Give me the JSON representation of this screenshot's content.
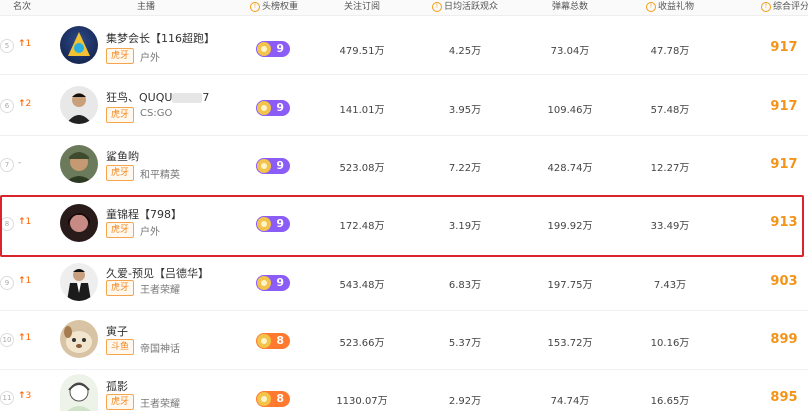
{
  "header": {
    "rank": "名次",
    "streamer": "主播",
    "weight": "头榜权重",
    "subscribers": "关注订阅",
    "daily_active": "日均活跃观众",
    "danmaku": "弹幕总数",
    "gifts": "收益礼物",
    "score": "综合评分"
  },
  "rows": [
    {
      "rank": "5",
      "trend": "1",
      "trend_dir": "up",
      "name": "集梦会长【116超跑】",
      "platform": "虎牙",
      "category": "户外",
      "weight": "9",
      "weight_tier": "purple",
      "subscribers": "479.51万",
      "daily_active": "4.25万",
      "danmaku": "73.04万",
      "gifts": "47.78万",
      "score": "917"
    },
    {
      "rank": "6",
      "trend": "2",
      "trend_dir": "up",
      "name_prefix": "狂鸟、QUQU",
      "name_suffix": "7",
      "platform": "虎牙",
      "category": "CS:GO",
      "weight": "9",
      "weight_tier": "purple",
      "subscribers": "141.01万",
      "daily_active": "3.95万",
      "danmaku": "109.46万",
      "gifts": "57.48万",
      "score": "917"
    },
    {
      "rank": "7",
      "trend": "-",
      "trend_dir": "flat",
      "name": "鲨鱼哟",
      "platform": "虎牙",
      "category": "和平精英",
      "weight": "9",
      "weight_tier": "purple",
      "subscribers": "523.08万",
      "daily_active": "7.22万",
      "danmaku": "428.74万",
      "gifts": "12.27万",
      "score": "917"
    },
    {
      "rank": "8",
      "trend": "1",
      "trend_dir": "up",
      "name": "童锦程【798】",
      "platform": "虎牙",
      "category": "户外",
      "weight": "9",
      "weight_tier": "purple",
      "subscribers": "172.48万",
      "daily_active": "3.19万",
      "danmaku": "199.92万",
      "gifts": "33.49万",
      "score": "913"
    },
    {
      "rank": "9",
      "trend": "1",
      "trend_dir": "up",
      "name": "久爱-预见【吕德华】",
      "platform": "虎牙",
      "category": "王者荣耀",
      "weight": "9",
      "weight_tier": "purple",
      "subscribers": "543.48万",
      "daily_active": "6.83万",
      "danmaku": "197.75万",
      "gifts": "7.43万",
      "score": "903"
    },
    {
      "rank": "10",
      "trend": "1",
      "trend_dir": "up",
      "name": "寅子",
      "platform": "斗鱼",
      "category": "帝国神话",
      "weight": "8",
      "weight_tier": "orange",
      "subscribers": "523.66万",
      "daily_active": "5.37万",
      "danmaku": "153.72万",
      "gifts": "10.16万",
      "score": "899"
    },
    {
      "rank": "11",
      "trend": "3",
      "trend_dir": "up",
      "name": "孤影",
      "platform": "虎牙",
      "category": "王者荣耀",
      "weight": "8",
      "weight_tier": "orange",
      "subscribers": "1130.07万",
      "daily_active": "2.92万",
      "danmaku": "74.74万",
      "gifts": "16.65万",
      "score": "895"
    }
  ],
  "colors": {
    "accent": "#f39418",
    "highlight": "#d9232d",
    "purple_badge": "#8b5cf6",
    "orange_badge": "#ff7a2f"
  }
}
